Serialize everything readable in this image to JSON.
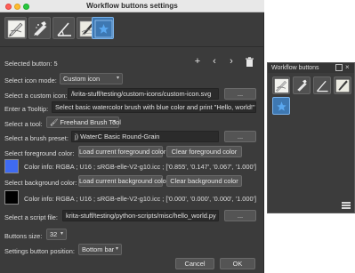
{
  "window": {
    "title": "Workflow buttons settings"
  },
  "form": {
    "selected_button_label": "Selected button:",
    "selected_button_value": "5",
    "icon_mode_label": "Select icon mode:",
    "icon_mode_value": "Custom icon",
    "custom_icon_label": "Select a custom icon:",
    "custom_icon_value": "/krita-stuff/testing/custom-icons/custom-icon.svg",
    "tooltip_label": "Enter a Tooltip:",
    "tooltip_value": "Select basic watercolor brush with blue color and print \"Hello, world!\"",
    "tool_label": "Select a tool:",
    "tool_value": "Freehand Brush Tool",
    "preset_label": "Select a brush preset:",
    "preset_value": "j) WaterC Basic Round-Grain",
    "fg_label": "Select foreground color:",
    "fg_load": "Load current foreground color",
    "fg_clear": "Clear foreground color",
    "fg_info": "Color info: RGBA ; U16 ; sRGB-elle-V2-g10.icc ; ['0.855', '0.147', '0.067', '1.000']",
    "bg_label": "Select background color:",
    "bg_load": "Load current background color",
    "bg_clear": "Clear background color",
    "bg_info": "Color info: RGBA ; U16 ; sRGB-elle-V2-g10.icc ; ['0.000', '0.000', '0.000', '1.000']",
    "script_label": "Select a script file:",
    "script_value": "krita-stuff/testing/python-scripts/misc/hello_world.py",
    "browse": "...",
    "size_label": "Buttons size:",
    "size_value": "32",
    "position_label": "Settings button position:",
    "position_value": "Bottom bar",
    "cancel": "Cancel",
    "ok": "OK"
  },
  "colors": {
    "fg_swatch": "#3f6bf2",
    "bg_swatch": "#000000",
    "selected_accent": "#3e78b2"
  },
  "toolbar_icons": [
    "brush-presets-icon",
    "airbrush-icon",
    "angle-tool-icon",
    "pen-sketch-icon",
    "custom-star-icon"
  ],
  "docker": {
    "title": "Workflow buttons"
  }
}
